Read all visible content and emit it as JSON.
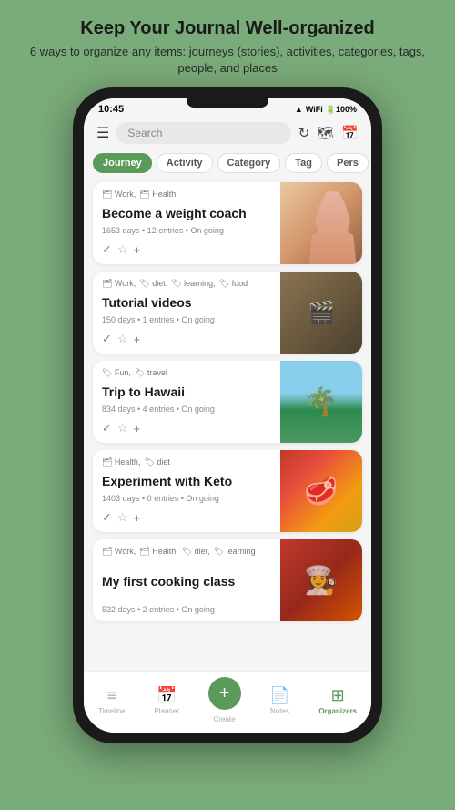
{
  "header": {
    "title": "Keep Your Journal Well-organized",
    "subtitle": "6 ways to organize any items: journeys (stories), activities, categories, tags, people, and places"
  },
  "statusBar": {
    "time": "10:45",
    "icons": "📶 🔋 100%"
  },
  "topBar": {
    "searchPlaceholder": "Search",
    "refreshLabel": "refresh",
    "mapLabel": "map",
    "calendarLabel": "calendar"
  },
  "filterTabs": [
    {
      "label": "Journey",
      "active": true
    },
    {
      "label": "Activity",
      "active": false
    },
    {
      "label": "Category",
      "active": false
    },
    {
      "label": "Tag",
      "active": false
    },
    {
      "label": "Pers",
      "active": false
    }
  ],
  "cards": [
    {
      "tags": "🗂 Work, 🗂 Health",
      "title": "Become a weight coach",
      "meta": "1653 days • 12 entries • On going",
      "imageClass": "img-fitness"
    },
    {
      "tags": "🗂 Work, 🏷 diet, 🏷 learning, 🏷 food",
      "title": "Tutorial videos",
      "meta": "150 days • 1 entries • On going",
      "imageClass": "img-tutorial"
    },
    {
      "tags": "🏷 Fun, 🏷 travel",
      "title": "Trip to Hawaii",
      "meta": "834 days • 4 entries • On going",
      "imageClass": "img-hawaii"
    },
    {
      "tags": "🗂 Health, 🏷 diet",
      "title": "Experiment with Keto",
      "meta": "1403 days • 0 entries • On going",
      "imageClass": "img-keto"
    },
    {
      "tags": "🗂 Work, 🗂 Health, 🏷 diet, 🏷 learning",
      "title": "My first cooking class",
      "meta": "532 days • 2 entries • On going",
      "imageClass": "img-cooking"
    }
  ],
  "bottomNav": [
    {
      "label": "Timeline",
      "icon": "☰",
      "active": false
    },
    {
      "label": "Planner",
      "icon": "📅",
      "active": false
    },
    {
      "label": "Create",
      "icon": "+",
      "active": false,
      "isCreate": true
    },
    {
      "label": "Notes",
      "icon": "📄",
      "active": false
    },
    {
      "label": "Organizers",
      "icon": "⊞",
      "active": true
    }
  ]
}
